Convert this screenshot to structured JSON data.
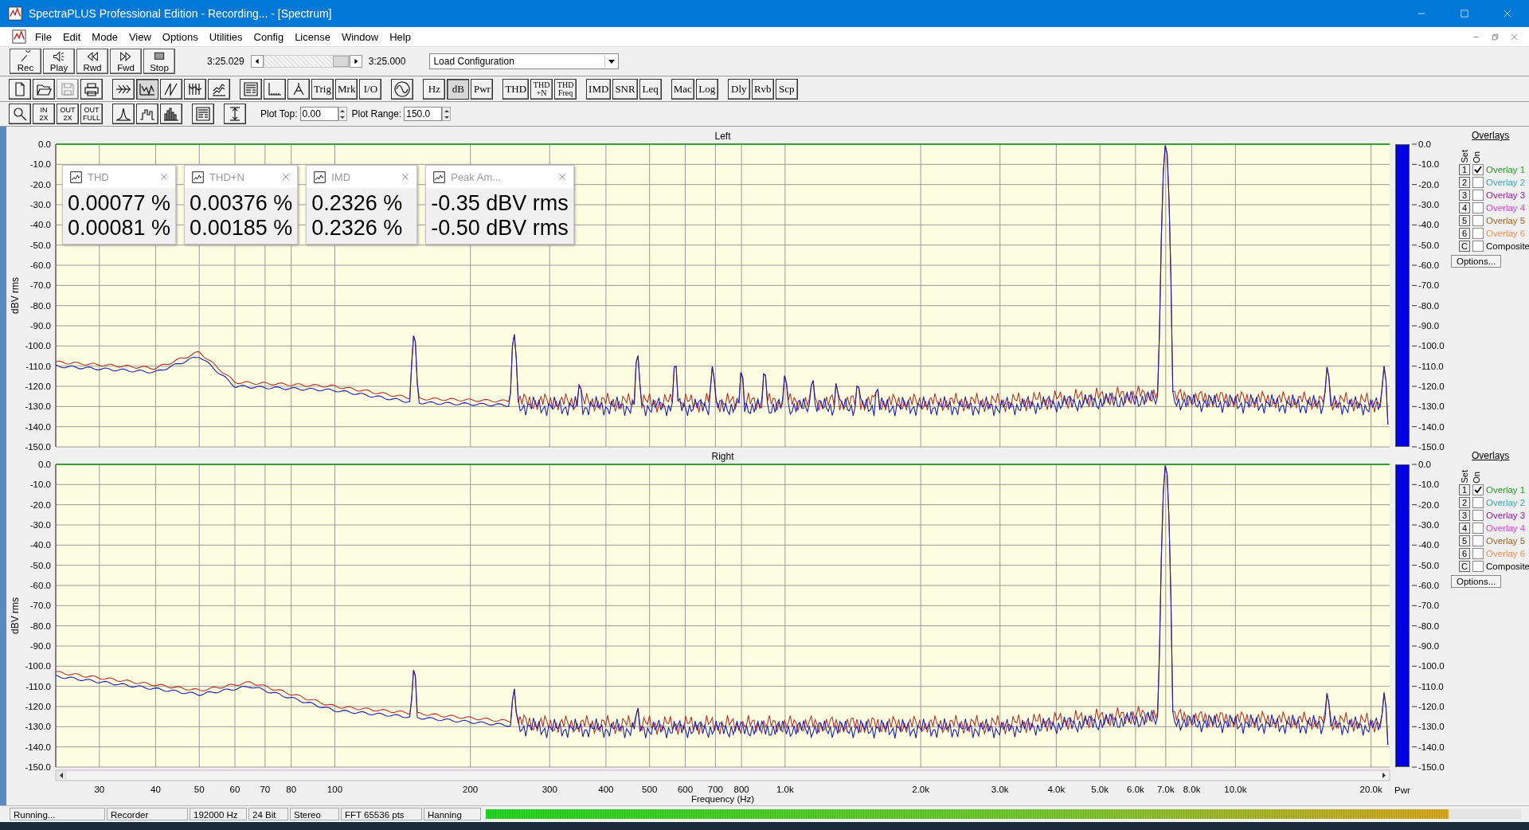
{
  "window": {
    "title": "SpectraPLUS Professional Edition - Recording... - [Spectrum]"
  },
  "menu": [
    "File",
    "Edit",
    "Mode",
    "View",
    "Options",
    "Utilities",
    "Config",
    "License",
    "Window",
    "Help"
  ],
  "transport": [
    {
      "label": "Rec"
    },
    {
      "label": "Play"
    },
    {
      "label": "Rwd"
    },
    {
      "label": "Fwd"
    },
    {
      "label": "Stop"
    }
  ],
  "position": {
    "start": "3:25.029",
    "end": "3:25.000"
  },
  "config_dropdown": {
    "value": "Load Configuration"
  },
  "toolbar": {
    "groups": [
      {
        "buttons": [
          {
            "kind": "icon",
            "pressed": false,
            "disabled": false
          },
          {
            "kind": "icon",
            "pressed": false,
            "disabled": false
          },
          {
            "kind": "icon",
            "pressed": false,
            "disabled": true
          },
          {
            "kind": "icon",
            "pressed": false,
            "disabled": false
          }
        ]
      },
      {
        "buttons": [
          {
            "kind": "icon",
            "pressed": false,
            "disabled": false
          },
          {
            "kind": "icon",
            "pressed": true,
            "disabled": false
          },
          {
            "kind": "icon",
            "pressed": false,
            "disabled": false
          },
          {
            "kind": "icon",
            "pressed": false,
            "disabled": false
          },
          {
            "kind": "icon",
            "pressed": false,
            "disabled": false
          }
        ]
      },
      {
        "buttons": [
          {
            "kind": "icon",
            "pressed": false,
            "disabled": false
          },
          {
            "kind": "icon",
            "pressed": false,
            "disabled": false
          },
          {
            "kind": "icon",
            "pressed": false,
            "disabled": false
          },
          {
            "kind": "text",
            "lines": [
              "Trig"
            ],
            "pressed": false,
            "disabled": false
          },
          {
            "kind": "text",
            "lines": [
              "Mrk"
            ],
            "pressed": false,
            "disabled": false
          },
          {
            "kind": "text",
            "lines": [
              "I/O"
            ],
            "pressed": false,
            "disabled": false
          }
        ]
      },
      {
        "buttons": [
          {
            "kind": "icon",
            "pressed": false,
            "disabled": false
          }
        ]
      },
      {
        "buttons": [
          {
            "kind": "text",
            "lines": [
              "Hz"
            ],
            "pressed": false,
            "disabled": false
          },
          {
            "kind": "text",
            "lines": [
              "dB"
            ],
            "pressed": true,
            "disabled": false
          },
          {
            "kind": "text",
            "lines": [
              "Pwr"
            ],
            "pressed": false,
            "disabled": false
          }
        ]
      },
      {
        "buttons": [
          {
            "kind": "text",
            "lines": [
              "THD"
            ],
            "pressed": false,
            "disabled": false
          },
          {
            "kind": "text",
            "lines": [
              "THD",
              "+N"
            ],
            "pressed": false,
            "disabled": false
          },
          {
            "kind": "text",
            "lines": [
              "THD",
              "Freq"
            ],
            "pressed": false,
            "disabled": false
          }
        ]
      },
      {
        "buttons": [
          {
            "kind": "text",
            "lines": [
              "IMD"
            ],
            "pressed": false,
            "disabled": false
          },
          {
            "kind": "text",
            "lines": [
              "SNR"
            ],
            "pressed": false,
            "disabled": false
          },
          {
            "kind": "text",
            "lines": [
              "Leq"
            ],
            "pressed": false,
            "disabled": false
          }
        ]
      },
      {
        "buttons": [
          {
            "kind": "text",
            "lines": [
              "Mac"
            ],
            "pressed": false,
            "disabled": false
          },
          {
            "kind": "text",
            "lines": [
              "Log"
            ],
            "pressed": false,
            "disabled": false
          }
        ]
      },
      {
        "buttons": [
          {
            "kind": "text",
            "lines": [
              "Dly"
            ],
            "pressed": false,
            "disabled": false
          },
          {
            "kind": "text",
            "lines": [
              "Rvb"
            ],
            "pressed": false,
            "disabled": false
          },
          {
            "kind": "text",
            "lines": [
              "Scp"
            ],
            "pressed": false,
            "disabled": false
          }
        ]
      }
    ]
  },
  "view_toolbar": {
    "groups": [
      {
        "buttons": [
          {
            "kind": "icon"
          },
          {
            "kind": "zoom",
            "lines": [
              "IN",
              "2X"
            ]
          },
          {
            "kind": "zoom",
            "lines": [
              "OUT",
              "2X"
            ]
          },
          {
            "kind": "zoom",
            "lines": [
              "OUT",
              "FULL"
            ]
          }
        ]
      },
      {
        "buttons": [
          {
            "kind": "icon"
          },
          {
            "kind": "icon"
          },
          {
            "kind": "icon"
          }
        ]
      },
      {
        "buttons": [
          {
            "kind": "icon"
          }
        ]
      },
      {
        "buttons": [
          {
            "kind": "icon"
          }
        ]
      }
    ],
    "plot_top": {
      "label": "Plot Top:",
      "value": "0.00"
    },
    "plot_range": {
      "label": "Plot Range:",
      "value": "150.0"
    }
  },
  "charts": [
    {
      "title": "Left",
      "ylabel": "dBV rms",
      "y_ticks": [
        "0.0",
        "-10.0",
        "-20.0",
        "-30.0",
        "-40.0",
        "-50.0",
        "-60.0",
        "-70.0",
        "-80.0",
        "-90.0",
        "-100.0",
        "-110.0",
        "-120.0",
        "-130.0",
        "-140.0",
        "-150.0"
      ],
      "meter": {
        "level": 1
      },
      "meter_scale": [
        "0.0",
        "-10.0",
        "-20.0",
        "-30.0",
        "-40.0",
        "-50.0",
        "-60.0",
        "-70.0",
        "-80.0",
        "-90.0",
        "-100.0",
        "-110.0",
        "-120.0",
        "-130.0",
        "-140.0",
        "-150.0"
      ],
      "measurements": [
        {
          "title": "THD",
          "values": [
            "0.00077 %",
            "0.00081 %"
          ]
        },
        {
          "title": "THD+N",
          "values": [
            "0.00376 %",
            "0.00185 %"
          ]
        },
        {
          "title": "IMD",
          "values": [
            "0.2326 %",
            "0.2326 %"
          ]
        },
        {
          "title": "Peak Am...",
          "values": [
            "-0.35 dBV rms",
            "-0.50 dBV rms"
          ]
        }
      ],
      "overlays": {
        "title": "Overlays",
        "set_header": "Set",
        "on_header": "On",
        "options": "Options...",
        "rows": [
          {
            "set": "1",
            "label": "Overlay 1",
            "on": true,
            "color": "#2a9a2a"
          },
          {
            "set": "2",
            "label": "Overlay 2",
            "on": false,
            "color": "#3aabb0"
          },
          {
            "set": "3",
            "label": "Overlay 3",
            "on": false,
            "color": "#9a1aa0"
          },
          {
            "set": "4",
            "label": "Overlay 4",
            "on": false,
            "color": "#e040e0"
          },
          {
            "set": "5",
            "label": "Overlay 5",
            "on": false,
            "color": "#a0642a"
          },
          {
            "set": "6",
            "label": "Overlay 6",
            "on": false,
            "color": "#f0905a"
          },
          {
            "set": "C",
            "label": "Composite",
            "on": false,
            "color": "#000000"
          }
        ]
      }
    },
    {
      "title": "Right",
      "ylabel": "dBV rms",
      "xlabel": "Frequency (Hz)",
      "y_ticks": [
        "0.0",
        "-10.0",
        "-20.0",
        "-30.0",
        "-40.0",
        "-50.0",
        "-60.0",
        "-70.0",
        "-80.0",
        "-90.0",
        "-100.0",
        "-110.0",
        "-120.0",
        "-130.0",
        "-140.0",
        "-150.0"
      ],
      "x_ticks": [
        "30",
        "40",
        "50",
        "60",
        "70",
        "80",
        "100",
        "200",
        "300",
        "400",
        "500",
        "600",
        "700",
        "800",
        "1.0k",
        "2.0k",
        "3.0k",
        "4.0k",
        "5.0k",
        "6.0k",
        "7.0k",
        "8.0k",
        "10.0k",
        "20.0k"
      ],
      "meter": {
        "level": 1,
        "label": "Pwr"
      },
      "meter_scale": [
        "0.0",
        "-10.0",
        "-20.0",
        "-30.0",
        "-40.0",
        "-50.0",
        "-60.0",
        "-70.0",
        "-80.0",
        "-90.0",
        "-100.0",
        "-110.0",
        "-120.0",
        "-130.0",
        "-140.0",
        "-150.0"
      ],
      "overlays": {
        "title": "Overlays",
        "set_header": "Set",
        "on_header": "On",
        "options": "Options...",
        "rows": [
          {
            "set": "1",
            "label": "Overlay 1",
            "on": true,
            "color": "#2a9a2a"
          },
          {
            "set": "2",
            "label": "Overlay 2",
            "on": false,
            "color": "#3aabb0"
          },
          {
            "set": "3",
            "label": "Overlay 3",
            "on": false,
            "color": "#9a1aa0"
          },
          {
            "set": "4",
            "label": "Overlay 4",
            "on": false,
            "color": "#e040e0"
          },
          {
            "set": "5",
            "label": "Overlay 5",
            "on": false,
            "color": "#a0642a"
          },
          {
            "set": "6",
            "label": "Overlay 6",
            "on": false,
            "color": "#f0905a"
          },
          {
            "set": "C",
            "label": "Composite",
            "on": false,
            "color": "#000000"
          }
        ]
      }
    }
  ],
  "status_bar": {
    "fields": [
      "Running...",
      "Recorder",
      "192000 Hz",
      "24 Bit",
      "Stereo",
      "FFT 65536 pts",
      "Hanning"
    ],
    "input_level": {
      "level": 0.93
    }
  }
}
